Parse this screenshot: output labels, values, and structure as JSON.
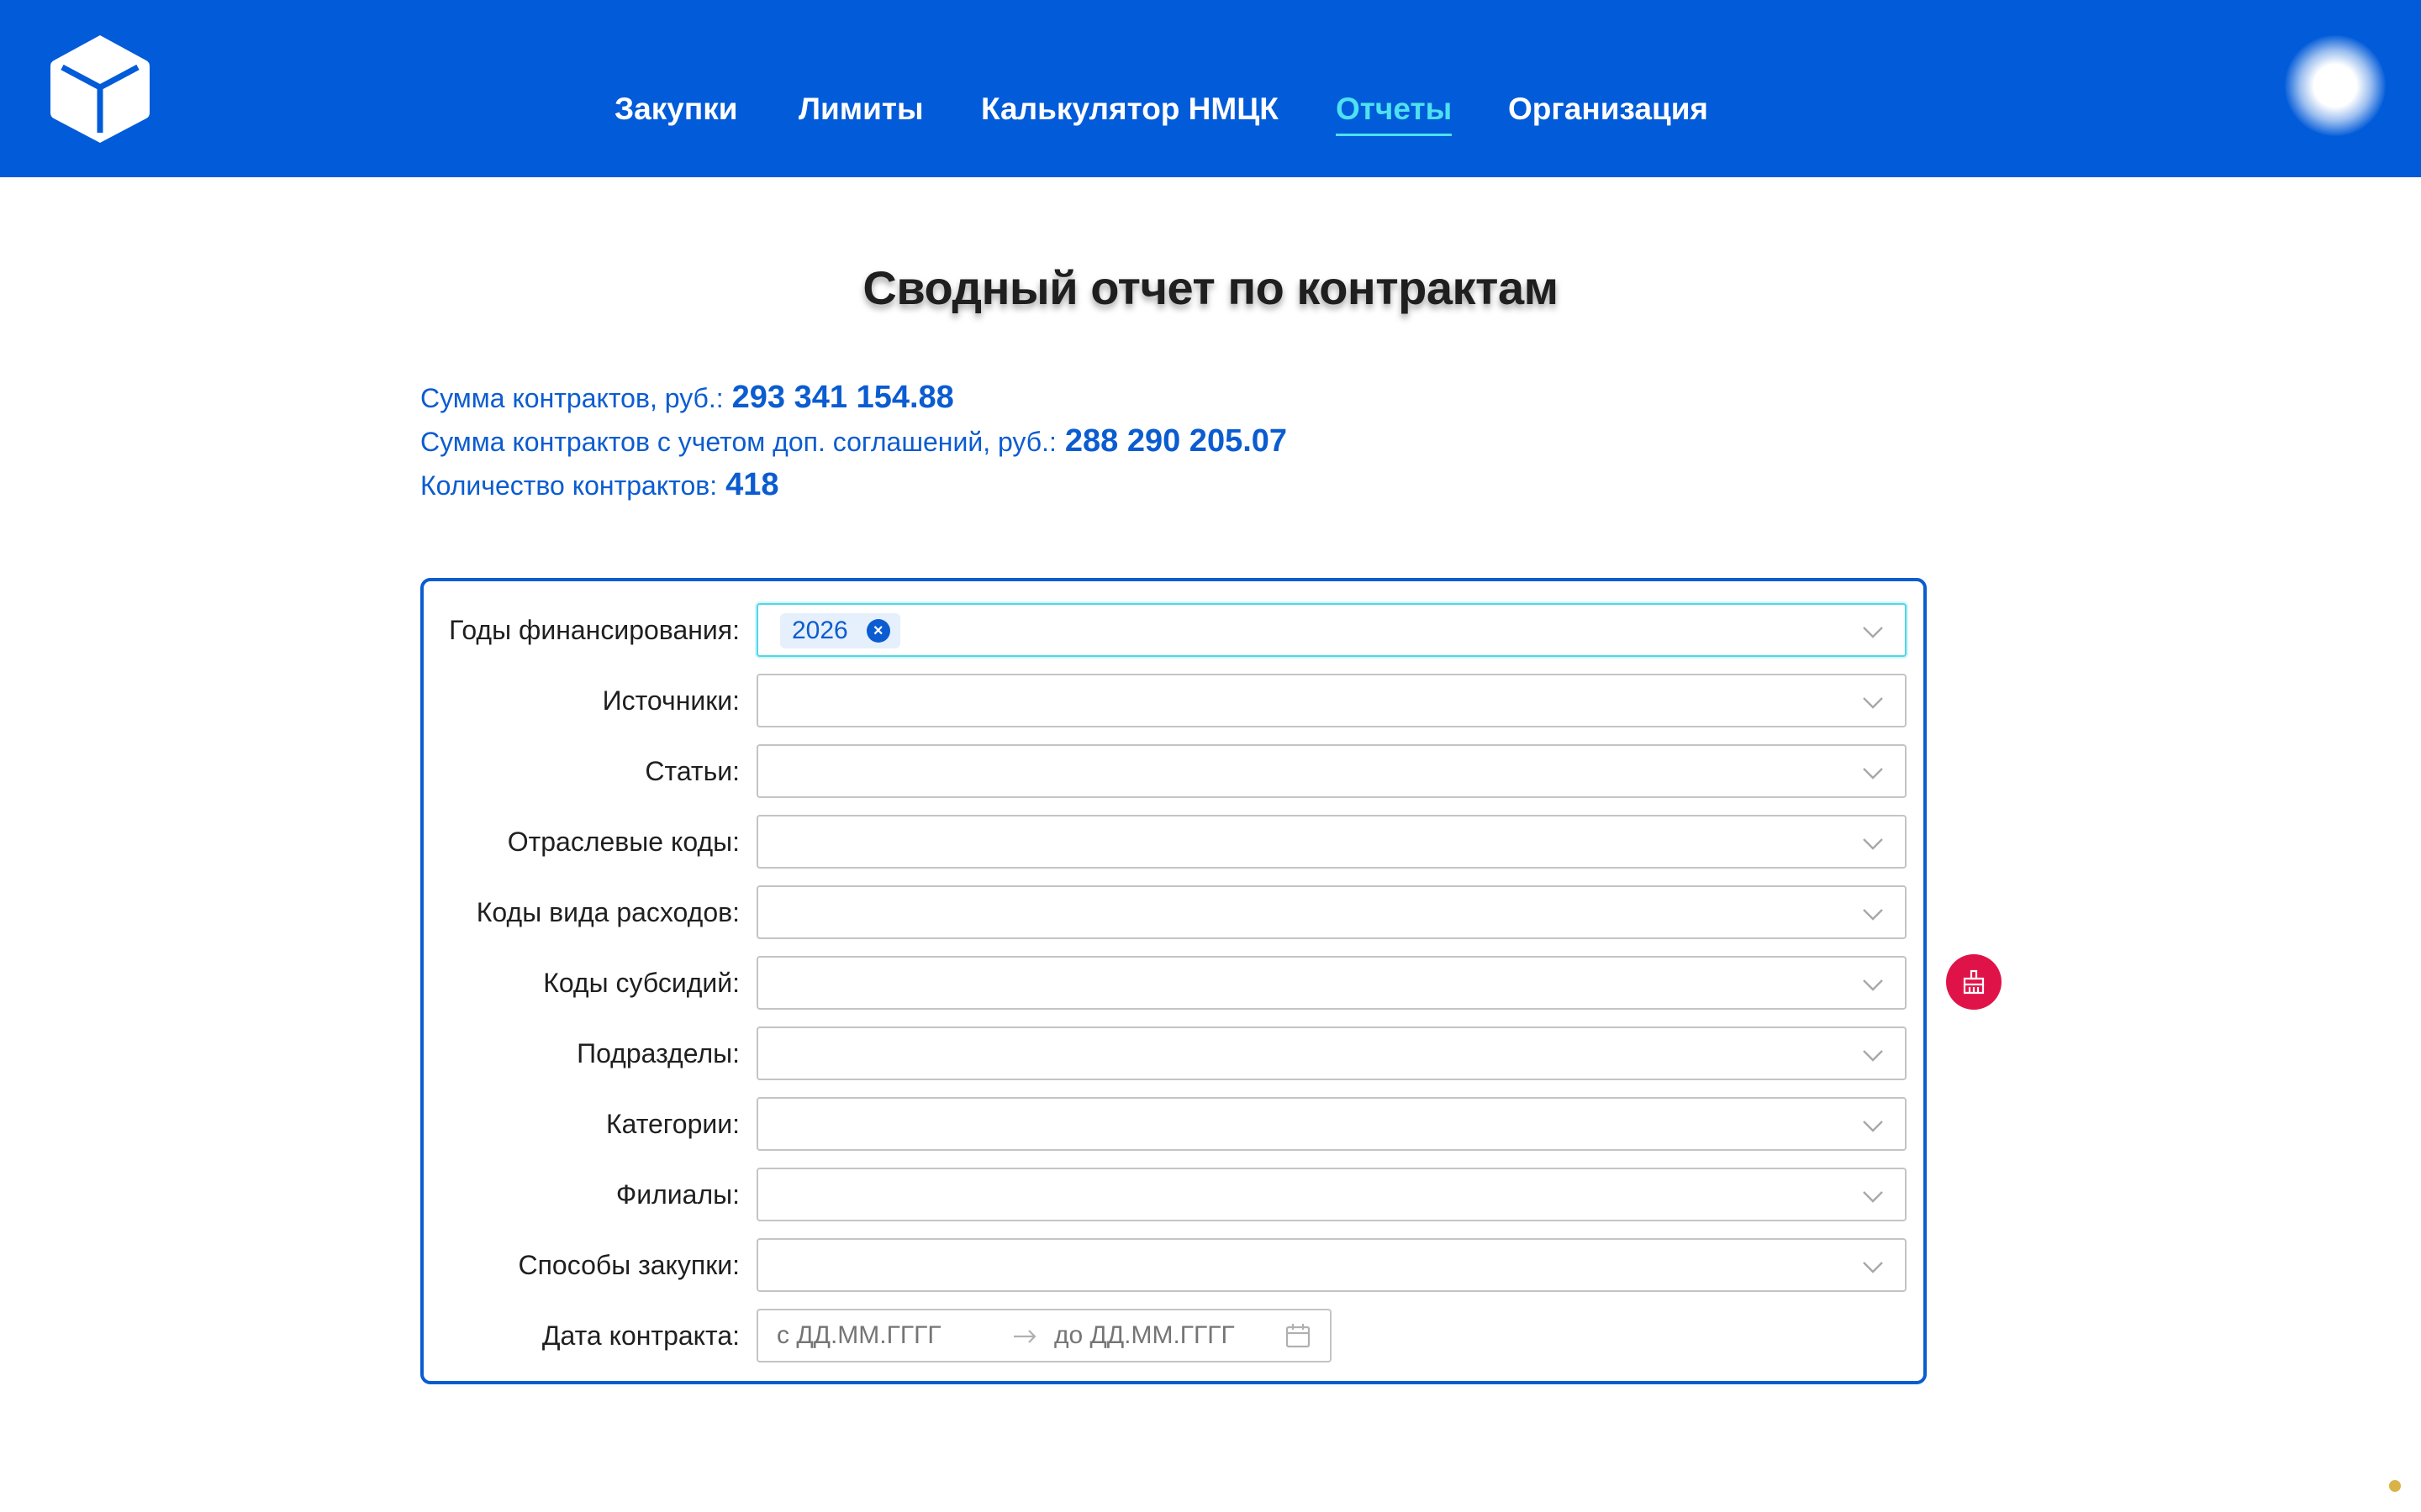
{
  "header": {
    "nav": [
      {
        "label": "Закупки",
        "active": false
      },
      {
        "label": "Лимиты",
        "active": false
      },
      {
        "label": "Калькулятор НМЦК",
        "active": false
      },
      {
        "label": "Отчеты",
        "active": true
      },
      {
        "label": "Организация",
        "active": false
      }
    ],
    "colors": {
      "bar": "#025bd9",
      "active": "#4ee1f0"
    }
  },
  "page": {
    "title": "Сводный отчет по контрактам"
  },
  "summary": {
    "total_label": "Сумма контрактов, руб.:",
    "total_value": "293 341 154.88",
    "total_with_agreements_label": "Сумма контрактов с учетом доп. соглашений, руб.:",
    "total_with_agreements_value": "288 290 205.07",
    "count_label": "Количество контрактов:",
    "count_value": "418"
  },
  "filters": {
    "financing_years": {
      "label": "Годы финансирования:",
      "selected_tags": [
        "2026"
      ]
    },
    "sources": {
      "label": "Источники:"
    },
    "articles": {
      "label": "Статьи:"
    },
    "industry_codes": {
      "label": "Отраслевые коды:"
    },
    "expense_type_codes": {
      "label": "Коды вида расходов:"
    },
    "subsidy_codes": {
      "label": "Коды субсидий:"
    },
    "subdivisions": {
      "label": "Подразделы:"
    },
    "categories": {
      "label": "Категории:"
    },
    "branches": {
      "label": "Филиалы:"
    },
    "procurement_methods": {
      "label": "Способы закупки:"
    },
    "contract_date": {
      "label": "Дата контракта:",
      "from_placeholder": "с ДД.ММ.ГГГГ",
      "to_placeholder": "до ДД.ММ.ГГГГ"
    }
  },
  "actions": {
    "clear_icon": "broom-icon",
    "clear_color": "#e01348"
  }
}
